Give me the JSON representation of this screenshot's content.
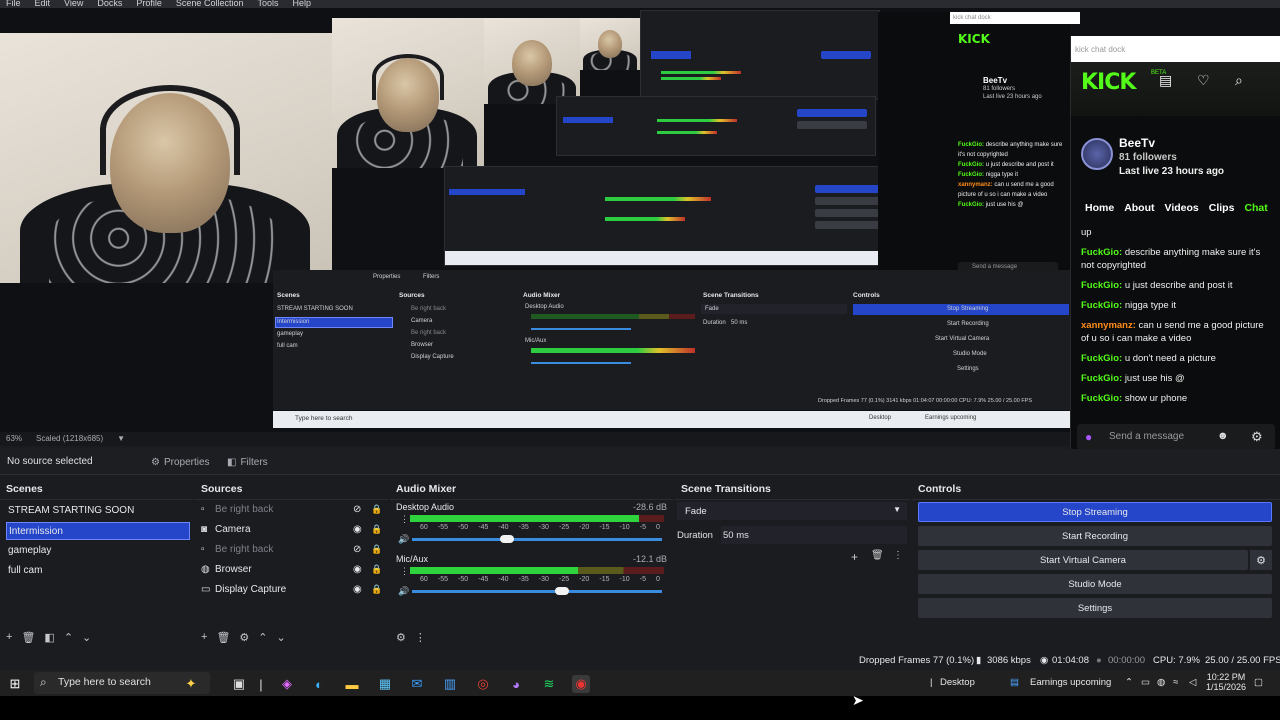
{
  "menu": [
    "File",
    "Edit",
    "View",
    "Docks",
    "Profile",
    "Scene Collection",
    "Tools",
    "Help"
  ],
  "preview": {
    "inner_dock_label": "kick chat dock",
    "inner_scenes_title": "Scenes",
    "inner_sources_title": "Sources",
    "inner_mixer_title": "Audio Mixer",
    "inner_transitions_title": "Scene Transitions",
    "inner_controls_title": "Controls",
    "inner_scenes": [
      "STREAM STARTING SOON",
      "Intermission",
      "gameplay",
      "full cam"
    ],
    "inner_sources": [
      "Be right back",
      "Camera",
      "Be right back",
      "Browser",
      "Display Capture"
    ],
    "inner_controls": [
      "Stop Streaming",
      "Start Recording",
      "Start Virtual Camera",
      "Studio Mode",
      "Settings"
    ],
    "inner_fade": "Fade",
    "inner_duration_label": "Duration",
    "inner_duration_value": "50 ms",
    "inner_desktop_audio": "Desktop Audio",
    "inner_mic": "Mic/Aux",
    "inner_properties": "Properties",
    "inner_filters": "Filters",
    "inner_search": "Type here to search",
    "inner_stats": "Dropped Frames 77 (0.1%)   3141 kbps   01:04:07   00:00:00   CPU: 7.9%   25.00 / 25.00 FPS",
    "inner_desktop": "Desktop",
    "inner_earnings": "Earnings upcoming"
  },
  "chat": {
    "dock_label": "kick chat dock",
    "logo": "KICK",
    "beta": "BETA",
    "channel_name": "BeeTv",
    "followers": "81 followers",
    "last_live": "Last live 23 hours ago",
    "nav": [
      "Home",
      "About",
      "Videos",
      "Clips",
      "Chat"
    ],
    "active_nav": "Chat",
    "messages": [
      {
        "user": "",
        "text": "up",
        "color": "green"
      },
      {
        "user": "FuckGio:",
        "text": "describe anything make sure it's not copyrighted",
        "color": "green"
      },
      {
        "user": "FuckGio:",
        "text": "u just describe and post it",
        "color": "green"
      },
      {
        "user": "FuckGio:",
        "text": "nigga type it",
        "color": "green"
      },
      {
        "user": "xannymanz:",
        "text": "can u send me a good picture of u so i can make a video",
        "color": "orange"
      },
      {
        "user": "FuckGio:",
        "text": "u don't need a picture",
        "color": "green"
      },
      {
        "user": "FuckGio:",
        "text": "just use his @",
        "color": "green"
      },
      {
        "user": "FuckGio:",
        "text": "show ur phone",
        "color": "green"
      }
    ],
    "send_placeholder": "Send a message"
  },
  "zoom": {
    "percent": "63%",
    "scaled": "Scaled (1218x685)"
  },
  "sourcebar": {
    "no_source": "No source selected",
    "properties": "Properties",
    "filters": "Filters"
  },
  "scenes": {
    "title": "Scenes",
    "items": [
      "STREAM STARTING SOON",
      "Intermission",
      "gameplay",
      "full cam"
    ],
    "selected": "Intermission"
  },
  "sources": {
    "title": "Sources",
    "items": [
      {
        "label": "Be right back",
        "icon": "group-icon",
        "visible": false
      },
      {
        "label": "Camera",
        "icon": "camera-icon",
        "visible": true
      },
      {
        "label": "Be right back",
        "icon": "group-icon",
        "visible": false
      },
      {
        "label": "Browser",
        "icon": "globe-icon",
        "visible": true
      },
      {
        "label": "Display Capture",
        "icon": "monitor-icon",
        "visible": true
      }
    ]
  },
  "mixer": {
    "title": "Audio Mixer",
    "channels": [
      {
        "name": "Desktop Audio",
        "db": "-28.6 dB",
        "level": 0.9,
        "volume": 0.38
      },
      {
        "name": "Mic/Aux",
        "db": "-12.1 dB",
        "level": 0.66,
        "volume": 0.6
      }
    ],
    "ticks": [
      "60",
      "-55",
      "-50",
      "-45",
      "-40",
      "-35",
      "-30",
      "-25",
      "-20",
      "-15",
      "-10",
      "-5",
      "0"
    ]
  },
  "transitions": {
    "title": "Scene Transitions",
    "type": "Fade",
    "duration_label": "Duration",
    "duration_value": "50 ms"
  },
  "controls": {
    "title": "Controls",
    "buttons": [
      "Stop Streaming",
      "Start Recording",
      "Start Virtual Camera",
      "Studio Mode",
      "Settings"
    ]
  },
  "status": {
    "dropped": "Dropped Frames 77 (0.1%)",
    "bitrate": "3086 kbps",
    "stream_time": "01:04:08",
    "rec_time": "00:00:00",
    "cpu": "CPU: 7.9%",
    "fps": "25.00 / 25.00 FPS"
  },
  "taskbar": {
    "search_placeholder": "Type here to search",
    "desktop_label": "Desktop",
    "earnings": "Earnings upcoming",
    "time": "10:22 PM",
    "date": "1/15/2026"
  },
  "colors": {
    "accent": "#2546c8",
    "kick_green": "#53fc18",
    "chat_orange": "#ff8c1a"
  }
}
